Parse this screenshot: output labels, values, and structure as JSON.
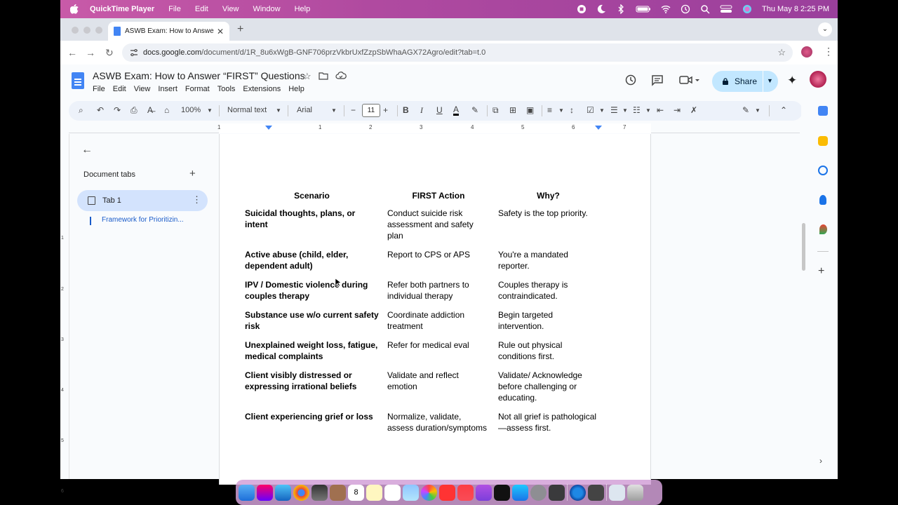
{
  "menubar": {
    "app_name": "QuickTime Player",
    "items": [
      "File",
      "Edit",
      "View",
      "Window",
      "Help"
    ],
    "clock": "Thu May 8  2:25 PM"
  },
  "browser": {
    "tab_title": "ASWB Exam: How to Answer",
    "url_host": "docs.google.com",
    "url_path": "/document/d/1R_8u6xWgB-GNF706przVkbrUxfZzpSbWhaAGX72Agro/edit?tab=t.0"
  },
  "doc": {
    "title": "ASWB Exam: How to Answer “FIRST” Questions",
    "menu": [
      "File",
      "Edit",
      "View",
      "Insert",
      "Format",
      "Tools",
      "Extensions",
      "Help"
    ],
    "share_label": "Share"
  },
  "toolbar": {
    "zoom": "100%",
    "style": "Normal text",
    "font": "Arial",
    "font_size": "11"
  },
  "ruler": {
    "numbers": [
      "1",
      "1",
      "2",
      "3",
      "4",
      "5",
      "6",
      "7"
    ]
  },
  "vruler": {
    "numbers": [
      "1",
      "2",
      "3",
      "4",
      "5",
      "6"
    ]
  },
  "sidepanel": {
    "heading": "Document tabs",
    "tab_label": "Tab 1",
    "outline_item": "Framework for Prioritizin..."
  },
  "table": {
    "headers": [
      "Scenario",
      "FIRST Action",
      "Why?"
    ],
    "rows": [
      [
        "Suicidal thoughts, plans, or intent",
        "Conduct suicide risk assessment and safety plan",
        "Safety is the top priority."
      ],
      [
        "Active abuse (child, elder, dependent adult)",
        "Report to CPS or APS",
        "You're a mandated reporter."
      ],
      [
        "IPV / Domestic violence during couples therapy",
        "Refer both partners to individual therapy",
        "Couples therapy is contraindicated."
      ],
      [
        "Substance use w/o current safety risk",
        "Coordinate addiction treatment",
        "Begin targeted intervention."
      ],
      [
        "Unexplained weight loss, fatigue, medical complaints",
        "Refer for medical eval",
        "Rule out physical conditions first."
      ],
      [
        "Client visibly distressed or expressing irrational beliefs",
        "Validate and reflect emotion",
        "Validate/ Acknowledge before challenging or educating."
      ],
      [
        "Client experiencing grief or loss",
        "Normalize, validate, assess duration/symptoms",
        "Not all grief is pathological—assess first."
      ]
    ]
  },
  "dock": {
    "calendar_day": "8"
  }
}
